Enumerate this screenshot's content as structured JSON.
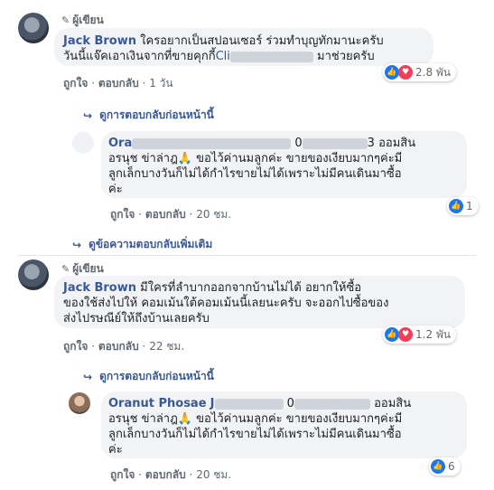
{
  "comment1": {
    "author_tag": "ผู้เขียน",
    "author": "Jack Brown",
    "line1": "ใครอยากเป็นสปอนเซอร์ ร่วมทำบุญทักมานะครับ",
    "line2_prefix": "วันนี้แจ๊คเอาเงินจากที่ขายคุกกี้",
    "line2_link": "Cli",
    "line2_suffix": "มาช่วยครับ",
    "actions": {
      "like": "ถูกใจ",
      "reply": "ตอบกลับ",
      "time": "1 วัน"
    },
    "reaction_count": "2.8 พัน",
    "prev_replies": "ดูการตอบกลับก่อนหน้านี้"
  },
  "reply1": {
    "name_prefix": "Ora",
    "phone_visible": "0",
    "phone_end": "3",
    "line1_suffix": "ออมสิน",
    "line2": "อรนุช ข่าล่าฎ🙏 ขอไว้ค่านมลูกค่ะ ขายของเงียบมากๆค่ะมี",
    "line3": "ลูกเล็กบางวันก็ไม่ได้กำไรขายไม่ได้เพราะไม่มีคนเดินมาซื้อ",
    "line4": "ค่ะ",
    "actions": {
      "like": "ถูกใจ",
      "reply": "ตอบกลับ",
      "time": "20 ชม."
    },
    "reaction_count": "1"
  },
  "more_replies": "ดูข้อความตอบกลับเพิ่มเติม",
  "comment2": {
    "author_tag": "ผู้เขียน",
    "author": "Jack Brown",
    "line1": "มีใครที่ลำบากออกจากบ้านไม่ได้ อยากให้ซื้อ",
    "line2": "ของใช้ส่งไปให้ คอมเม้นใต้คอมเม้นนี้เลยนะครับ จะออกไปซื้อของ",
    "line3": "ส่งไปรษณีย์ให้ถึงบ้านเลยครับ",
    "actions": {
      "like": "ถูกใจ",
      "reply": "ตอบกลับ",
      "time": "22 ชม."
    },
    "reaction_count": "1.2 พัน",
    "prev_replies": "ดูการตอบกลับก่อนหน้านี้"
  },
  "reply2": {
    "name": "Oranut Phosae",
    "name_tail": "J",
    "phone_visible": "0",
    "line1_suffix": "ออมสิน",
    "line2": "อรนุช ข่าล่าฎ🙏 ขอไว้ค่านมลูกค่ะ ขายของเงียบมากๆค่ะมี",
    "line3": "ลูกเล็กบางวันก็ไม่ได้กำไรขายไม่ได้เพราะไม่มีคนเดินมาซื้อ",
    "line4": "ค่ะ",
    "actions": {
      "like": "ถูกใจ",
      "reply": "ตอบกลับ",
      "time": "20 ชม."
    },
    "reaction_count": "6"
  }
}
